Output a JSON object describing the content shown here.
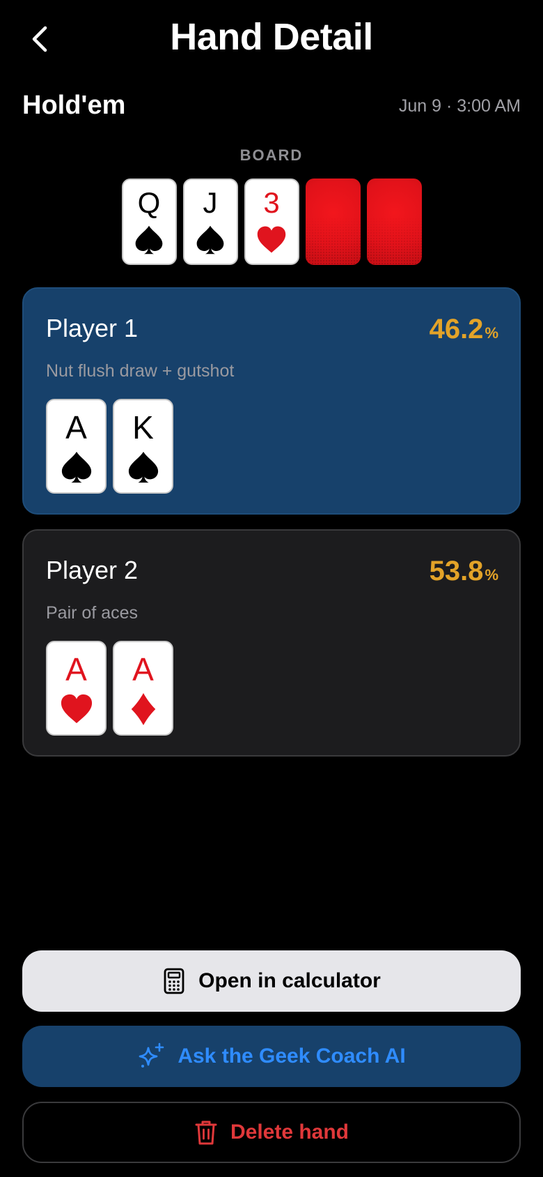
{
  "header": {
    "title": "Hand Detail",
    "back_icon": "chevron-left-icon"
  },
  "hand": {
    "game_type": "Hold'em",
    "datetime": "Jun 9 · 3:00 AM"
  },
  "board": {
    "label": "BOARD",
    "cards": [
      {
        "rank": "Q",
        "suit": "spades",
        "color": "black"
      },
      {
        "rank": "J",
        "suit": "spades",
        "color": "black"
      },
      {
        "rank": "3",
        "suit": "hearts",
        "color": "red"
      }
    ],
    "hidden_cards": 2
  },
  "players": [
    {
      "name": "Player 1",
      "equity": "46.2",
      "equity_unit": "%",
      "description": "Nut flush draw + gutshot",
      "cards": [
        {
          "rank": "A",
          "suit": "spades",
          "color": "black"
        },
        {
          "rank": "K",
          "suit": "spades",
          "color": "black"
        }
      ]
    },
    {
      "name": "Player 2",
      "equity": "53.8",
      "equity_unit": "%",
      "description": "Pair of aces",
      "cards": [
        {
          "rank": "A",
          "suit": "hearts",
          "color": "red"
        },
        {
          "rank": "A",
          "suit": "diamonds",
          "color": "red"
        }
      ]
    }
  ],
  "actions": {
    "calculator": {
      "label": "Open in calculator",
      "icon": "calculator-icon"
    },
    "coach": {
      "label": "Ask the Geek Coach AI",
      "icon": "sparkles-icon"
    },
    "delete": {
      "label": "Delete hand",
      "icon": "trash-icon"
    }
  },
  "colors": {
    "background": "#000000",
    "player1_panel": "#17416B",
    "player2_panel": "#1C1C1E",
    "equity": "#E3A328",
    "coach_text": "#2F8CFF",
    "delete_text": "#E0383A",
    "card_red": "#E0141E"
  }
}
